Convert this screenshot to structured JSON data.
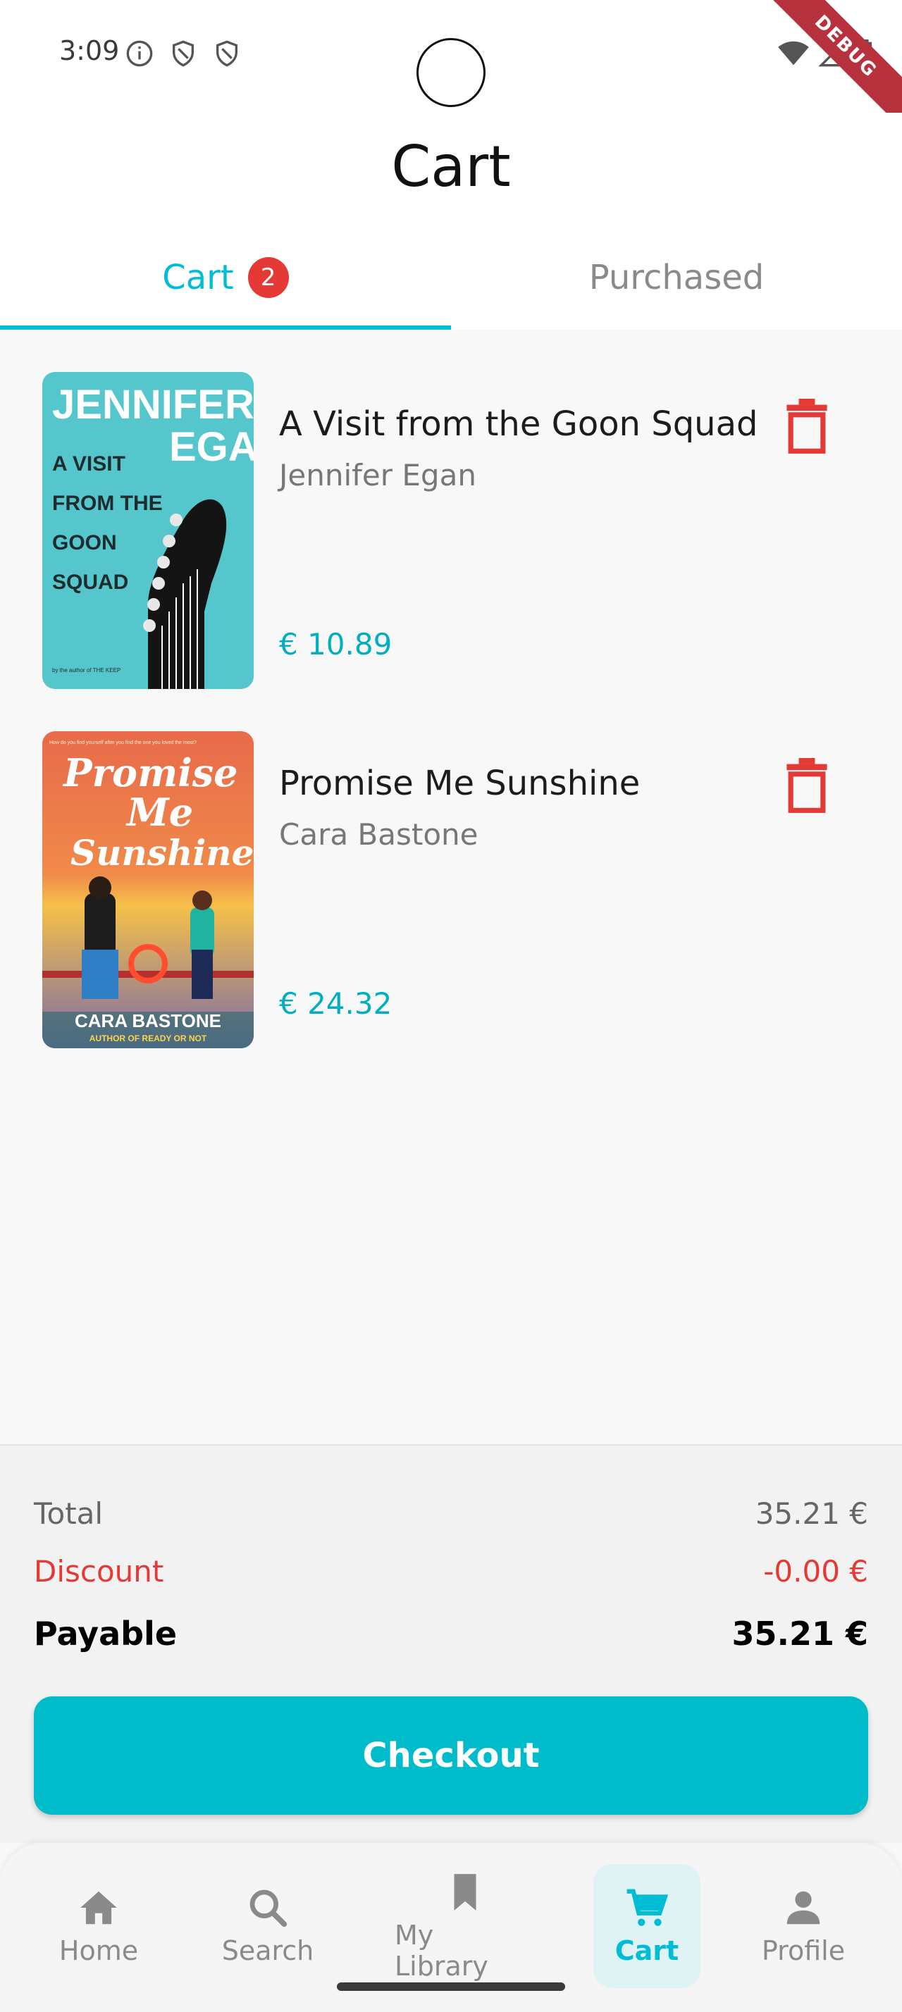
{
  "status_bar": {
    "time": "3:09",
    "debug_label": "DEBUG"
  },
  "header": {
    "title": "Cart"
  },
  "tabs": [
    {
      "label": "Cart",
      "badge": "2",
      "active": true
    },
    {
      "label": "Purchased",
      "active": false
    }
  ],
  "cart_items": [
    {
      "title": "A Visit from the Goon Squad",
      "author": "Jennifer Egan",
      "price": "€ 10.89",
      "cover": {
        "line1": "JENNIFER",
        "line2": "EGAN",
        "line3": "A VISIT",
        "line4": "FROM THE",
        "line5": "GOON",
        "line6": "SQUAD",
        "footer": "by the author of THE KEEP",
        "bg": "#55c6cb"
      }
    },
    {
      "title": "Promise Me Sunshine",
      "author": "Cara Bastone",
      "price": "€ 24.32",
      "cover": {
        "script1": "Promise",
        "script2": "Me",
        "script3": "Sunshine",
        "author": "CARA BASTONE",
        "sub": "AUTHOR OF READY OR NOT",
        "tagline": "How do you find yourself after you find the one you loved the most?",
        "bg": "#e8643f"
      }
    }
  ],
  "summary": {
    "total_label": "Total",
    "total_value": "35.21 €",
    "discount_label": "Discount",
    "discount_value": "-0.00 €",
    "payable_label": "Payable",
    "payable_value": "35.21 €",
    "checkout_label": "Checkout"
  },
  "bottom_nav": [
    {
      "label": "Home",
      "icon": "home-icon",
      "active": false
    },
    {
      "label": "Search",
      "icon": "search-icon",
      "active": false
    },
    {
      "label": "My Library",
      "icon": "bookmark-icon",
      "active": false
    },
    {
      "label": "Cart",
      "icon": "cart-icon",
      "active": true
    },
    {
      "label": "Profile",
      "icon": "person-icon",
      "active": false
    }
  ],
  "colors": {
    "accent": "#00bcd4",
    "danger": "#e53935"
  }
}
